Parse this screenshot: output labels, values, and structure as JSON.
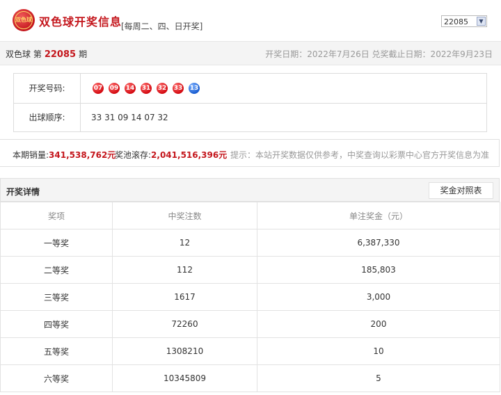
{
  "header": {
    "logo_text": "双色球",
    "brand": "双色球开奖信息",
    "schedule": "[每周二、四、日开奖]",
    "issue_select": "22085"
  },
  "draw_bar": {
    "prefix": "双色球 第",
    "issue": "22085",
    "suffix": "期",
    "dates": "开奖日期：2022年7月26日 兑奖截止日期：2022年9月23日"
  },
  "numbers": {
    "label": "开奖号码:",
    "red": [
      "07",
      "09",
      "14",
      "31",
      "32",
      "33"
    ],
    "blue": "13",
    "order_label": "出球顺序:",
    "order": "33 31 09 14 07 32"
  },
  "sales": {
    "label": "本期销量:",
    "value": "341,538,762元",
    "pool_label": "奖池滚存:",
    "pool_value": "2,041,516,396元",
    "tip": "提示：本站开奖数据仅供参考，中奖查询以彩票中心官方开奖信息为准"
  },
  "details": {
    "title": "开奖详情",
    "compare_button": "奖金对照表",
    "columns": [
      "奖项",
      "中奖注数",
      "单注奖金（元）"
    ],
    "rows": [
      [
        "一等奖",
        "12",
        "6,387,330"
      ],
      [
        "二等奖",
        "112",
        "185,803"
      ],
      [
        "三等奖",
        "1617",
        "3,000"
      ],
      [
        "四等奖",
        "72260",
        "200"
      ],
      [
        "五等奖",
        "1308210",
        "10"
      ],
      [
        "六等奖",
        "10345809",
        "5"
      ]
    ]
  },
  "colors": {
    "accent_red": "#c4161c",
    "blue_ball": "#1a5ed1"
  },
  "icons": {
    "select_arrow": "chevron-down-icon",
    "logo": "lottery-logo-icon"
  }
}
